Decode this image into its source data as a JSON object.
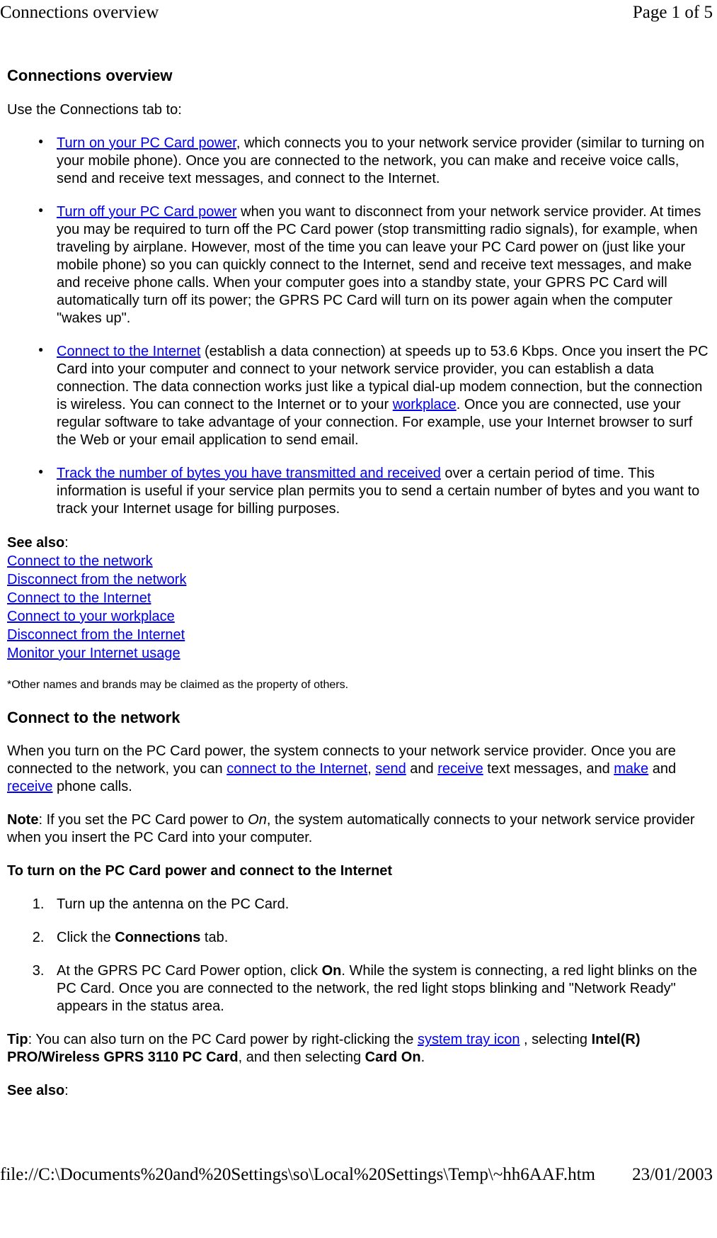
{
  "header": {
    "left": "Connections overview",
    "right": "Page 1 of 5"
  },
  "section1": {
    "title": "Connections overview",
    "intro": "Use the Connections tab to:",
    "bullets": {
      "b1": {
        "link": "Turn on your PC Card power",
        "rest": ", which connects you to your network service provider (similar to turning on your mobile phone). Once you are connected to the network, you can make and receive voice calls, send and receive text messages, and connect to the Internet."
      },
      "b2": {
        "link": "Turn off your PC Card power",
        "rest": " when you want to disconnect from your network service provider. At times you may be required to turn off the PC Card power (stop transmitting radio signals), for example, when traveling by airplane. However, most of the time you can leave your PC Card power on (just like your mobile phone) so you can quickly connect to the Internet, send and receive text messages, and make and receive phone calls. When your computer goes into a standby state, your GPRS PC Card will automatically turn off its power; the GPRS PC Card will turn on its power again when the computer \"wakes up\"."
      },
      "b3": {
        "link": "Connect to the Internet",
        "mid1": " (establish a data connection) at speeds up to 53.6 Kbps. Once you insert the PC Card into your computer and connect to your network service provider, you can establish a data connection. The data connection works just like a typical dial-up modem connection, but the connection is wireless. You can connect to the Internet or to your ",
        "link2": "workplace",
        "rest": ". Once you are connected, use your regular software to take advantage of your connection. For example, use your Internet browser to surf the Web or your email application to send email."
      },
      "b4": {
        "link": "Track the number of bytes you have transmitted and received",
        "rest": " over a certain period of time. This information is useful if your service plan permits you to send a certain number of bytes and you want to track your Internet usage for billing purposes."
      }
    },
    "see_also_label": "See also",
    "see_also_colon": ":",
    "see_also": {
      "l1": "Connect to the network",
      "l2": "Disconnect from the network",
      "l3": "Connect to the Internet",
      "l4": "Connect to your workplace",
      "l5": "Disconnect from the Internet",
      "l6": "Monitor your Internet usage"
    },
    "footnote": "*Other names and brands may be claimed as the property of others."
  },
  "section2": {
    "title": "Connect to the network",
    "p1": {
      "t1": "When you turn on the PC Card power, the system connects to your network service provider. Once you are connected to the network, you can ",
      "l1": "connect to the Internet",
      "t2": ", ",
      "l2": "send",
      "t3": " and ",
      "l3": "receive",
      "t4": " text messages, and ",
      "l4": "make",
      "t5": " and ",
      "l5": "receive",
      "t6": " phone calls."
    },
    "note": {
      "label": "Note",
      "t1": ": If you set the PC Card power to ",
      "italic": "On",
      "t2": ", the system automatically connects to your network service provider when you insert the PC Card into your computer."
    },
    "subhead": "To turn on the PC Card power and connect to the Internet",
    "steps": {
      "s1": "Turn up the antenna on the PC Card.",
      "s2": {
        "t1": "Click the ",
        "bold": "Connections",
        "t2": " tab."
      },
      "s3": {
        "t1": "At the GPRS PC Card Power option, click ",
        "bold": "On",
        "t2": ". While the system is connecting, a red light blinks on the PC Card. Once you are connected to the network, the red light stops blinking and \"Network Ready\" appears in the status area."
      }
    },
    "tip": {
      "label": "Tip",
      "t1": ": You can also turn on the PC Card power by right-clicking the ",
      "link": "system tray icon",
      "t2": " , selecting ",
      "bold1": "Intel(R) PRO/Wireless GPRS 3110 PC Card",
      "t3": ", and then selecting ",
      "bold2": "Card On",
      "t4": "."
    },
    "see_also_label": "See also",
    "see_also_colon": ":"
  },
  "footer": {
    "left": "file://C:\\Documents%20and%20Settings\\so\\Local%20Settings\\Temp\\~hh6AAF.htm",
    "right": "23/01/2003"
  }
}
